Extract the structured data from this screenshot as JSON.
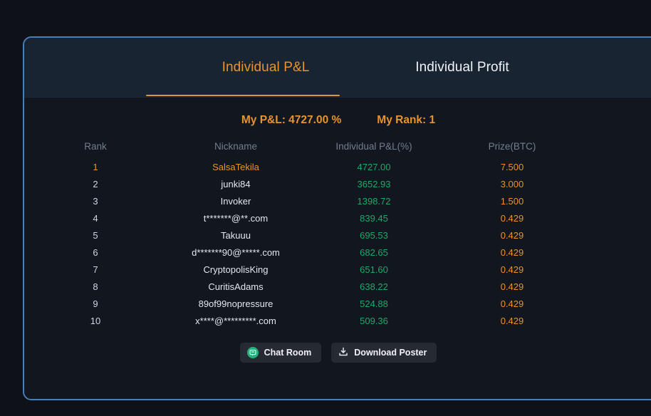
{
  "card": {
    "tabs": [
      {
        "label": "Individual P&L",
        "active": true
      },
      {
        "label": "Individual Profit",
        "active": false
      }
    ],
    "summary": {
      "my_pl": "My P&L: 4727.00 %",
      "my_rank": "My Rank: 1"
    },
    "table": {
      "columns": [
        "Rank",
        "Nickname",
        "Individual P&L(%)",
        "Prize(BTC)"
      ],
      "rows": [
        {
          "rank": "1",
          "nickname": "SalsaTekila",
          "pl": "4727.00",
          "prize": "7.500"
        },
        {
          "rank": "2",
          "nickname": "junki84",
          "pl": "3652.93",
          "prize": "3.000"
        },
        {
          "rank": "3",
          "nickname": "Invoker",
          "pl": "1398.72",
          "prize": "1.500"
        },
        {
          "rank": "4",
          "nickname": "t*******@**.com",
          "pl": "839.45",
          "prize": "0.429"
        },
        {
          "rank": "5",
          "nickname": "Takuuu",
          "pl": "695.53",
          "prize": "0.429"
        },
        {
          "rank": "6",
          "nickname": "d*******90@*****.com",
          "pl": "682.65",
          "prize": "0.429"
        },
        {
          "rank": "7",
          "nickname": "CryptopolisKing",
          "pl": "651.60",
          "prize": "0.429"
        },
        {
          "rank": "8",
          "nickname": "CuritisAdams",
          "pl": "638.22",
          "prize": "0.429"
        },
        {
          "rank": "9",
          "nickname": "89of99nopressure",
          "pl": "524.88",
          "prize": "0.429"
        },
        {
          "rank": "10",
          "nickname": "x****@*********.com",
          "pl": "509.36",
          "prize": "0.429"
        }
      ]
    },
    "footer": {
      "chat_label": "Chat Room",
      "chat_icon": "chat-bubble-icon",
      "download_label": "Download Poster",
      "download_icon": "download-icon"
    }
  },
  "colors": {
    "page_background": "#0e1117",
    "card_background": "#11161f",
    "card_header_background": "#192433",
    "card_border": "#4a7fb5",
    "accent_orange": "#e8932e",
    "underline_orange": "#d49a3c",
    "profit_green": "#1fa968",
    "header_text": "#737f8d",
    "chat_green": "#23b07a"
  }
}
